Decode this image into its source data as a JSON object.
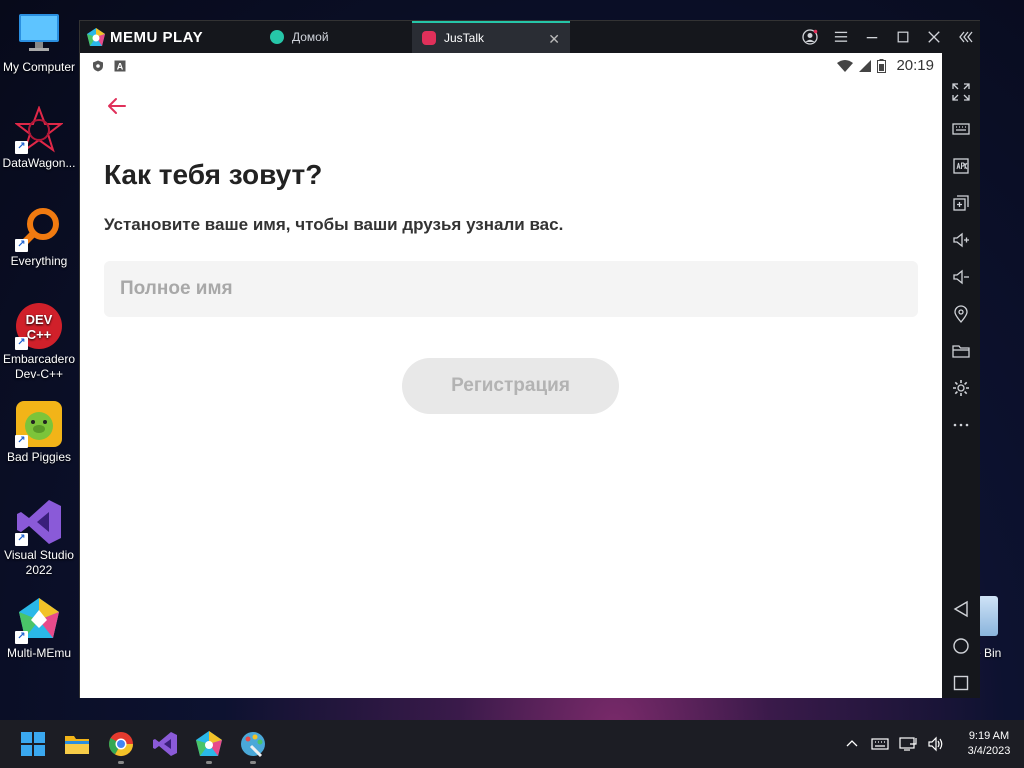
{
  "desktop": {
    "icons": [
      {
        "label": "My Computer"
      },
      {
        "label": "DataWagon..."
      },
      {
        "label": "Everything"
      },
      {
        "label": "Embarcadero Dev-C++"
      },
      {
        "label": "Bad Piggies"
      },
      {
        "label": "Visual Studio 2022"
      },
      {
        "label": "Multi-MEmu"
      }
    ],
    "recycle_bin_label": "e Bin"
  },
  "emulator": {
    "brand": "MEMU PLAY",
    "tabs": [
      {
        "label": "Домой"
      },
      {
        "label": "JusTalk",
        "close": "✕"
      }
    ]
  },
  "android": {
    "status": {
      "time": "20:19"
    },
    "heading": "Как тебя зовут?",
    "subheading": "Установите ваше имя, чтобы ваши друзья узнали вас.",
    "name_placeholder": "Полное имя",
    "register_label": "Регистрация"
  },
  "taskbar": {
    "time": "9:19 AM",
    "date": "3/4/2023"
  },
  "colors": {
    "accent_red": "#e0305a",
    "tab_accent": "#26c6a8"
  }
}
